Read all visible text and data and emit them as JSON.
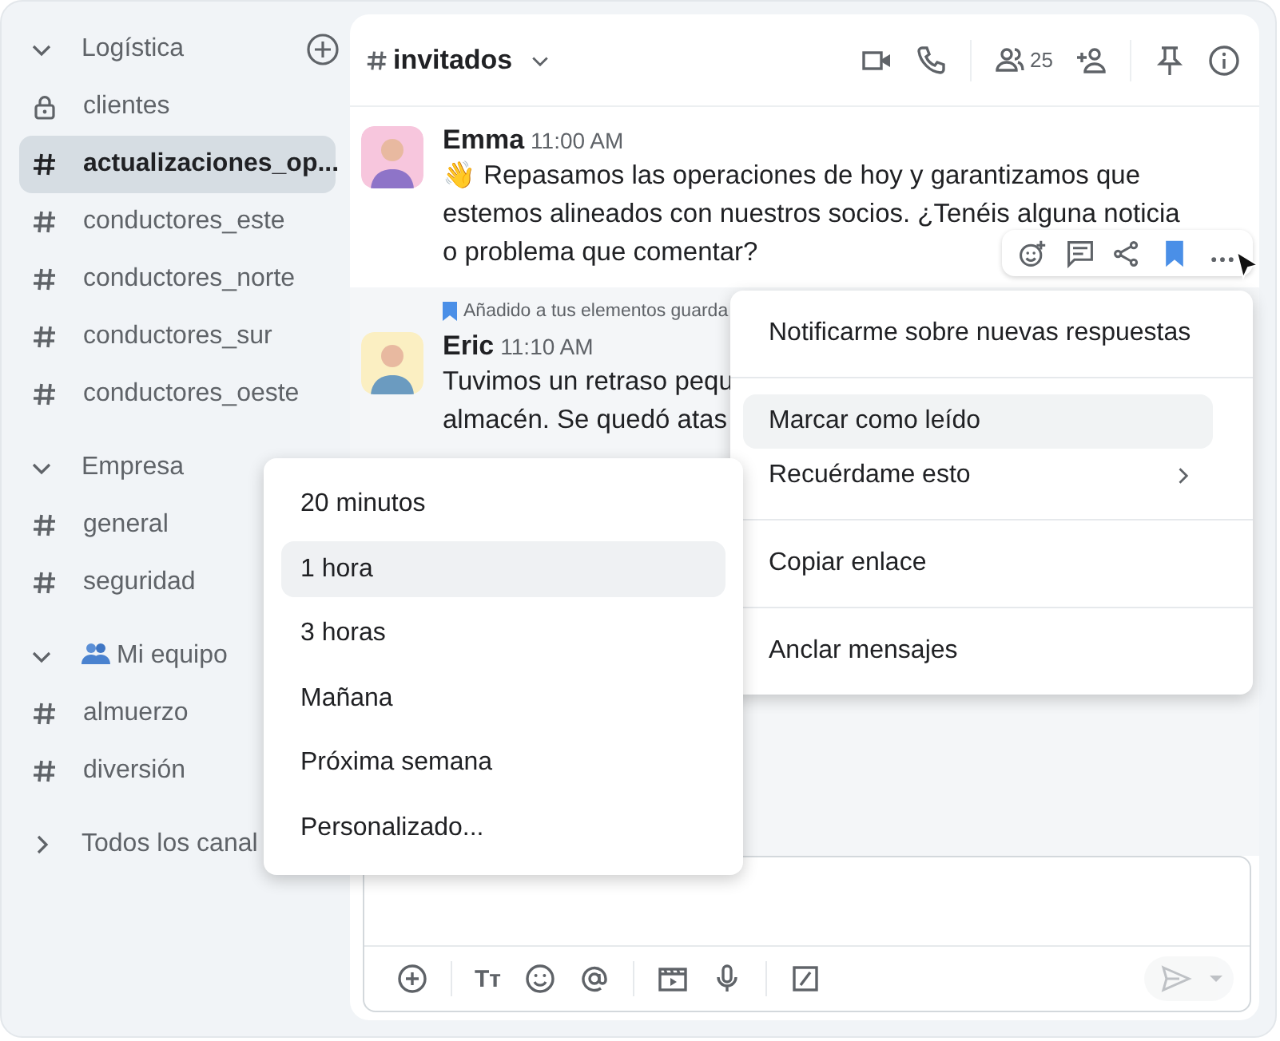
{
  "sidebar": {
    "sections": [
      {
        "title": "Logística",
        "expanded": true,
        "can_add": true,
        "kind": "plain",
        "items": [
          {
            "label": "clientes",
            "kind": "private",
            "selected": false
          },
          {
            "label": "actualizaciones_op...",
            "kind": "channel",
            "selected": true
          },
          {
            "label": "conductores_este",
            "kind": "channel",
            "selected": false
          },
          {
            "label": "conductores_norte",
            "kind": "channel",
            "selected": false
          },
          {
            "label": "conductores_sur",
            "kind": "channel",
            "selected": false
          },
          {
            "label": "conductores_oeste",
            "kind": "channel",
            "selected": false
          }
        ]
      },
      {
        "title": "Empresa",
        "expanded": true,
        "can_add": false,
        "kind": "plain",
        "items": [
          {
            "label": "general",
            "kind": "channel",
            "selected": false
          },
          {
            "label": "seguridad",
            "kind": "channel",
            "selected": false
          }
        ]
      },
      {
        "title": "Mi equipo",
        "expanded": true,
        "can_add": false,
        "kind": "team",
        "items": [
          {
            "label": "almuerzo",
            "kind": "channel",
            "selected": false
          },
          {
            "label": "diversión",
            "kind": "channel",
            "selected": false
          }
        ]
      },
      {
        "title": "Todos los canal",
        "expanded": false,
        "can_add": false,
        "kind": "plain"
      }
    ]
  },
  "header": {
    "channel": "invitados",
    "member_count": "25"
  },
  "messages": [
    {
      "author": "Emma",
      "time": "11:00 AM",
      "saved": false,
      "lines": [
        "👋 Repasamos las operaciones de hoy y garantizamos que",
        "estemos alineados con nuestros socios. ¿Tenéis alguna noticia",
        "o problema que comentar?"
      ]
    },
    {
      "author": "Eric",
      "time": "11:10 AM",
      "saved": true,
      "saved_note": "Añadido a tus elementos guarda",
      "lines": [
        "Tuvimos un retraso pequ",
        "almacén. Se quedó atas"
      ]
    }
  ],
  "message_actions": {
    "bookmarked": true
  },
  "context_menu": {
    "groups": [
      [
        {
          "label": "Notificarme sobre nuevas respuestas",
          "selected": false,
          "submenu": false
        }
      ],
      [
        {
          "label": "Marcar como leído",
          "selected": true,
          "submenu": false
        },
        {
          "label": "Recuérdame esto",
          "selected": false,
          "submenu": true
        }
      ],
      [
        {
          "label": "Copiar enlace",
          "selected": false,
          "submenu": false
        }
      ],
      [
        {
          "label": "Anclar mensajes",
          "selected": false,
          "submenu": false
        }
      ]
    ]
  },
  "reminder_menu": {
    "items": [
      {
        "label": "20 minutos",
        "selected": false
      },
      {
        "label": "1 hora",
        "selected": true
      },
      {
        "label": "3 horas",
        "selected": false
      },
      {
        "label": "Mañana",
        "selected": false
      },
      {
        "label": "Próxima semana",
        "selected": false
      },
      {
        "label": "Personalizado...",
        "selected": false
      }
    ]
  },
  "composer": {
    "format_label": "Tт",
    "send_enabled": false
  }
}
